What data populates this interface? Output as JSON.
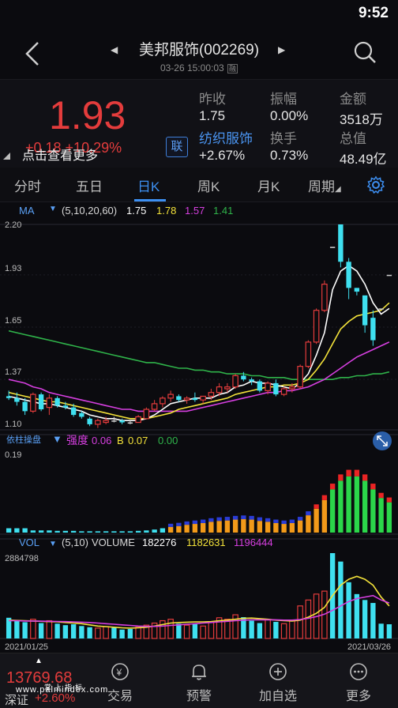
{
  "status": {
    "time": "9:52"
  },
  "header": {
    "title": "美邦服饰(002269)",
    "subtime": "03-26 15:00:03",
    "subtime_badge": "融"
  },
  "quote": {
    "price": "1.93",
    "change": "+0.18 +10.29%",
    "more_label": "点击查看更多",
    "lian_label": "联",
    "fields": [
      {
        "label": "昨收",
        "value": "1.75"
      },
      {
        "label": "振幅",
        "value": "0.00%"
      },
      {
        "label": "金额",
        "value": "3518万"
      },
      {
        "label": "纺织服饰",
        "value": "+2.67%"
      },
      {
        "label": "换手",
        "value": "0.73%"
      },
      {
        "label": "总值",
        "value": "48.49亿"
      }
    ]
  },
  "tabs": [
    "分时",
    "五日",
    "日K",
    "周K",
    "月K",
    "周期"
  ],
  "active_tab": "日K",
  "ma": {
    "label": "MA",
    "params": "(5,10,20,60)",
    "values": [
      "1.75",
      "1.78",
      "1.57",
      "1.41"
    ],
    "colors": [
      "#ffffff",
      "#f4e33a",
      "#d63fe0",
      "#2fb34a"
    ]
  },
  "indicator": {
    "label": "依柱操盘",
    "strength_label": "强度",
    "strength_value": "0.06",
    "b_label": "B",
    "b_value": "0.07",
    "c_value": "0.00",
    "ymax": "0.19"
  },
  "volume": {
    "label": "VOL",
    "params": "(5,10)",
    "title": "VOLUME",
    "values": [
      "182276",
      "1182631",
      "1196444"
    ],
    "ymax": "2884798",
    "date_start": "2021/01/25",
    "date_end": "2021/03/26"
  },
  "price_axis": [
    "2.20",
    "1.93",
    "1.65",
    "1.37",
    "1.10"
  ],
  "bottom_nav": {
    "index_value": "13769.68",
    "index_name": "深证",
    "index_change": "+2.60%",
    "items": [
      "交易",
      "预警",
      "加自选",
      "更多"
    ],
    "watermark": "www.palmindex.com",
    "watermark_cn": "掌上指标"
  },
  "colors": {
    "up": "#e43c3c",
    "down": "#3fe0f0",
    "accent": "#3d8ff1",
    "ma5": "#ffffff",
    "ma10": "#f4e33a",
    "ma20": "#d63fe0",
    "ma60": "#2fb34a"
  },
  "chart_data": {
    "type": "candlestick",
    "candles": [
      [
        1.28,
        1.31,
        1.26,
        1.27
      ],
      [
        1.27,
        1.3,
        1.23,
        1.25
      ],
      [
        1.25,
        1.27,
        1.18,
        1.2
      ],
      [
        1.2,
        1.3,
        1.19,
        1.29
      ],
      [
        1.29,
        1.3,
        1.2,
        1.21
      ],
      [
        1.22,
        1.29,
        1.18,
        1.27
      ],
      [
        1.27,
        1.28,
        1.22,
        1.23
      ],
      [
        1.23,
        1.25,
        1.21,
        1.22
      ],
      [
        1.22,
        1.24,
        1.17,
        1.18
      ],
      [
        1.19,
        1.2,
        1.16,
        1.17
      ],
      [
        1.16,
        1.17,
        1.12,
        1.13
      ],
      [
        1.13,
        1.16,
        1.11,
        1.15
      ],
      [
        1.14,
        1.17,
        1.13,
        1.15
      ],
      [
        1.15,
        1.17,
        1.14,
        1.15
      ],
      [
        1.15,
        1.16,
        1.13,
        1.14
      ],
      [
        1.14,
        1.15,
        1.13,
        1.14
      ],
      [
        1.14,
        1.18,
        1.14,
        1.17
      ],
      [
        1.16,
        1.22,
        1.16,
        1.21
      ],
      [
        1.21,
        1.26,
        1.2,
        1.24
      ],
      [
        1.24,
        1.28,
        1.22,
        1.27
      ],
      [
        1.27,
        1.31,
        1.25,
        1.29
      ],
      [
        1.28,
        1.29,
        1.25,
        1.26
      ],
      [
        1.26,
        1.28,
        1.24,
        1.27
      ],
      [
        1.27,
        1.3,
        1.25,
        1.26
      ],
      [
        1.26,
        1.28,
        1.24,
        1.28
      ],
      [
        1.28,
        1.32,
        1.26,
        1.3
      ],
      [
        1.3,
        1.35,
        1.28,
        1.33
      ],
      [
        1.32,
        1.35,
        1.3,
        1.33
      ],
      [
        1.33,
        1.4,
        1.32,
        1.39
      ],
      [
        1.39,
        1.41,
        1.36,
        1.37
      ],
      [
        1.37,
        1.38,
        1.34,
        1.36
      ],
      [
        1.36,
        1.37,
        1.3,
        1.31
      ],
      [
        1.31,
        1.36,
        1.29,
        1.35
      ],
      [
        1.35,
        1.37,
        1.28,
        1.29
      ],
      [
        1.29,
        1.33,
        1.28,
        1.32
      ],
      [
        1.32,
        1.35,
        1.3,
        1.33
      ],
      [
        1.33,
        1.45,
        1.32,
        1.44
      ],
      [
        1.44,
        1.58,
        1.43,
        1.57
      ],
      [
        1.57,
        1.75,
        1.56,
        1.74
      ],
      [
        1.74,
        1.9,
        1.73,
        1.88
      ],
      [
        2.08,
        2.08,
        2.08,
        2.08
      ],
      [
        2.2,
        2.2,
        1.97,
        2.0
      ],
      [
        2.0,
        2.02,
        1.8,
        1.86
      ],
      [
        1.86,
        1.86,
        1.82,
        1.84
      ],
      [
        1.82,
        1.8,
        1.62,
        1.66
      ],
      [
        1.7,
        1.74,
        1.55,
        1.58
      ],
      [
        1.75,
        1.75,
        1.75,
        1.75
      ],
      [
        1.93,
        1.93,
        1.93,
        1.93
      ]
    ],
    "ma5": [
      1.28,
      1.27,
      1.26,
      1.25,
      1.24,
      1.24,
      1.23,
      1.22,
      1.21,
      1.2,
      1.18,
      1.17,
      1.16,
      1.16,
      1.15,
      1.15,
      1.15,
      1.16,
      1.18,
      1.21,
      1.24,
      1.25,
      1.26,
      1.27,
      1.27,
      1.27,
      1.29,
      1.3,
      1.33,
      1.34,
      1.36,
      1.35,
      1.35,
      1.34,
      1.33,
      1.32,
      1.35,
      1.4,
      1.5,
      1.62,
      1.85,
      1.95,
      1.98,
      1.95,
      1.88,
      1.78,
      1.72,
      1.75
    ],
    "ma10": [
      1.3,
      1.29,
      1.28,
      1.27,
      1.26,
      1.25,
      1.25,
      1.24,
      1.23,
      1.22,
      1.21,
      1.2,
      1.19,
      1.18,
      1.17,
      1.16,
      1.16,
      1.16,
      1.17,
      1.18,
      1.19,
      1.21,
      1.22,
      1.23,
      1.24,
      1.25,
      1.26,
      1.27,
      1.29,
      1.3,
      1.31,
      1.32,
      1.33,
      1.33,
      1.34,
      1.34,
      1.35,
      1.37,
      1.42,
      1.48,
      1.56,
      1.64,
      1.68,
      1.71,
      1.72,
      1.73,
      1.74,
      1.78
    ],
    "ma20": [
      1.37,
      1.36,
      1.35,
      1.33,
      1.32,
      1.3,
      1.29,
      1.28,
      1.27,
      1.26,
      1.25,
      1.24,
      1.23,
      1.22,
      1.21,
      1.21,
      1.2,
      1.2,
      1.2,
      1.2,
      1.2,
      1.2,
      1.2,
      1.21,
      1.22,
      1.23,
      1.24,
      1.25,
      1.26,
      1.27,
      1.28,
      1.29,
      1.3,
      1.3,
      1.31,
      1.31,
      1.32,
      1.33,
      1.35,
      1.37,
      1.4,
      1.43,
      1.46,
      1.49,
      1.51,
      1.53,
      1.55,
      1.57
    ],
    "ma60": [
      1.63,
      1.62,
      1.61,
      1.6,
      1.59,
      1.58,
      1.57,
      1.56,
      1.55,
      1.54,
      1.53,
      1.52,
      1.51,
      1.5,
      1.49,
      1.48,
      1.47,
      1.46,
      1.46,
      1.45,
      1.44,
      1.43,
      1.43,
      1.42,
      1.42,
      1.41,
      1.41,
      1.4,
      1.4,
      1.4,
      1.39,
      1.39,
      1.38,
      1.38,
      1.38,
      1.37,
      1.37,
      1.37,
      1.37,
      1.37,
      1.37,
      1.38,
      1.38,
      1.39,
      1.39,
      1.4,
      1.4,
      1.41
    ],
    "indicator_strength": [
      0.01,
      0.01,
      0.01,
      0.005,
      0.005,
      0.005,
      0.004,
      0.004,
      0.004,
      0.003,
      0.003,
      0.003,
      0.003,
      0.003,
      0.003,
      0.003,
      0.004,
      0.005,
      0.007,
      0.01,
      0.013,
      0.015,
      0.018,
      0.02,
      0.022,
      0.025,
      0.027,
      0.028,
      0.03,
      0.031,
      0.03,
      0.027,
      0.025,
      0.022,
      0.02,
      0.022,
      0.028,
      0.04,
      0.055,
      0.075,
      0.1,
      0.12,
      0.13,
      0.13,
      0.12,
      0.1,
      0.08,
      0.07
    ],
    "volume": [
      700000,
      600000,
      550000,
      650000,
      520000,
      600000,
      500000,
      450000,
      480000,
      420000,
      380000,
      350000,
      400000,
      360000,
      300000,
      320000,
      380000,
      450000,
      520000,
      600000,
      650000,
      500000,
      450000,
      480000,
      420000,
      560000,
      700000,
      650000,
      800000,
      720000,
      600000,
      520000,
      640000,
      560000,
      500000,
      620000,
      1100000,
      1300000,
      1500000,
      1600000,
      2884798,
      2600000,
      1900000,
      1500000,
      1300000,
      1200000,
      500000,
      480000
    ],
    "vol_ma5": [
      620000,
      610000,
      600000,
      590000,
      580000,
      570000,
      560000,
      540000,
      520000,
      500000,
      460000,
      420000,
      400000,
      380000,
      360000,
      350000,
      360000,
      380000,
      420000,
      470000,
      520000,
      540000,
      550000,
      560000,
      560000,
      570000,
      600000,
      620000,
      650000,
      680000,
      690000,
      670000,
      650000,
      620000,
      600000,
      590000,
      620000,
      720000,
      850000,
      1050000,
      1450000,
      1800000,
      2000000,
      2100000,
      2000000,
      1800000,
      1400000,
      1100000
    ],
    "vol_ma10": [
      600000,
      600000,
      590000,
      590000,
      585000,
      580000,
      575000,
      570000,
      560000,
      550000,
      540000,
      520000,
      500000,
      480000,
      460000,
      440000,
      420000,
      410000,
      410000,
      420000,
      440000,
      460000,
      480000,
      500000,
      520000,
      540000,
      560000,
      580000,
      600000,
      620000,
      630000,
      630000,
      630000,
      630000,
      620000,
      620000,
      640000,
      680000,
      740000,
      820000,
      950000,
      1100000,
      1250000,
      1350000,
      1400000,
      1450000,
      1300000,
      1200000
    ],
    "price_ylim": [
      1.1,
      2.2
    ],
    "indicator_ylim": [
      0,
      0.19
    ],
    "volume_ylim": [
      0,
      2884798
    ]
  }
}
